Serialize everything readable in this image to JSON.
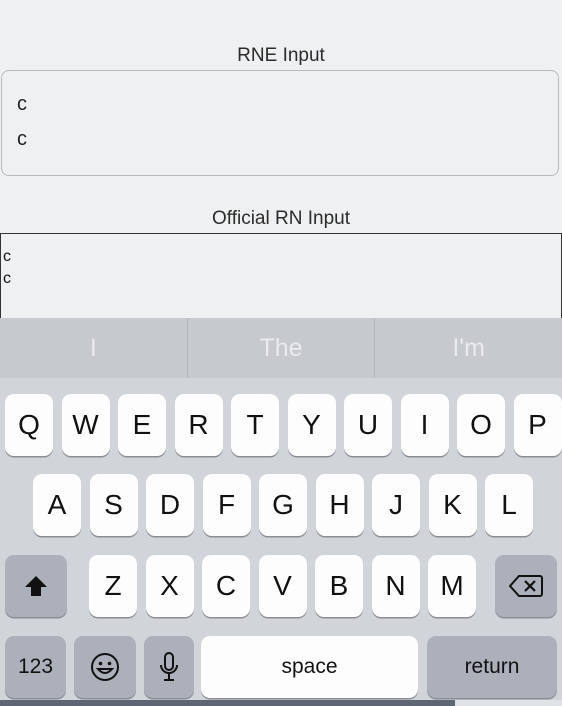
{
  "rne": {
    "label": "RNE Input",
    "value": "c\nc"
  },
  "official": {
    "label": "Official RN Input",
    "value": "c\nc"
  },
  "keyboard": {
    "suggestions": [
      "I",
      "The",
      "I'm"
    ],
    "row1": [
      "Q",
      "W",
      "E",
      "R",
      "T",
      "Y",
      "U",
      "I",
      "O",
      "P"
    ],
    "row2": [
      "A",
      "S",
      "D",
      "F",
      "G",
      "H",
      "J",
      "K",
      "L"
    ],
    "row3": [
      "Z",
      "X",
      "C",
      "V",
      "B",
      "N",
      "M"
    ],
    "numbers_label": "123",
    "space_label": "space",
    "return_label": "return",
    "icons": {
      "shift": "shift-icon",
      "delete": "delete-icon",
      "emoji": "emoji-icon",
      "mic": "microphone-icon"
    }
  }
}
